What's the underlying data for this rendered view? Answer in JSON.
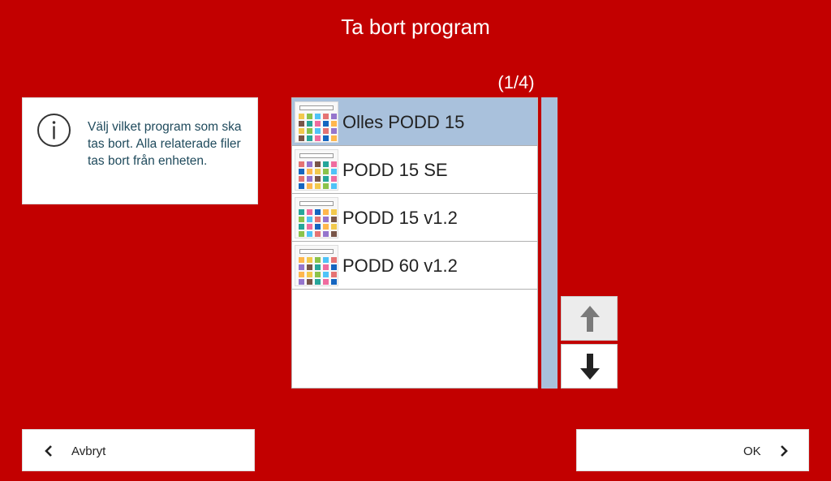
{
  "header": {
    "title": "Ta bort program",
    "counter": "(1/4)"
  },
  "info": {
    "icon": "info-icon",
    "text": "Välj vilket program som ska tas bort. Alla relaterade filer tas bort från enheten."
  },
  "programs": [
    {
      "name": "Olles PODD 15",
      "selected": true
    },
    {
      "name": "PODD 15 SE",
      "selected": false
    },
    {
      "name": "PODD 15 v1.2",
      "selected": false
    },
    {
      "name": "PODD 60 v1.2",
      "selected": false
    }
  ],
  "scroll": {
    "up_icon": "arrow-up-icon",
    "down_icon": "arrow-down-icon",
    "up_disabled": true
  },
  "footer": {
    "cancel_label": "Avbryt",
    "ok_label": "OK"
  },
  "colors": {
    "background": "#c20000",
    "selected": "#a9c1dc",
    "info_text": "#1f4a5c"
  }
}
